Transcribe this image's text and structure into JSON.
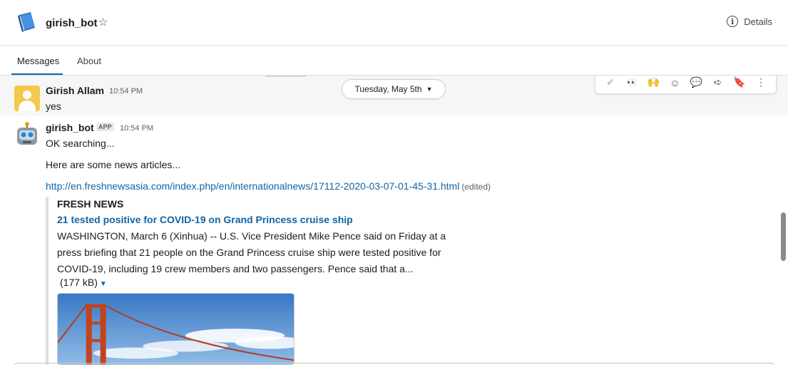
{
  "header": {
    "channel_name": "girish_bot",
    "details_label": "Details"
  },
  "tabs": [
    {
      "label": "Messages",
      "active": true
    },
    {
      "label": "About",
      "active": false
    }
  ],
  "date_divider": "Tuesday, May 5th",
  "message_actions": [
    "white-check-mark-icon",
    "eyes-icon",
    "raised-hands-icon",
    "add-reaction-icon",
    "reply-in-thread-icon",
    "share-icon",
    "bookmark-icon",
    "more-actions-icon"
  ],
  "messages": [
    {
      "sender": "Girish Allam",
      "time": "10:54 PM",
      "text": "yes"
    },
    {
      "sender": "girish_bot",
      "app_badge": "APP",
      "time": "10:54 PM",
      "lines": [
        "OK searching...",
        "Here are some news articles..."
      ],
      "link": "http://en.freshnewsasia.com/index.php/en/internationalnews/17112-2020-03-07-01-45-31.html",
      "edited": "(edited)",
      "attachment": {
        "source": "FRESH NEWS",
        "title": "21 tested positive for COVID-19 on Grand Princess cruise ship",
        "body_lines": [
          "WASHINGTON, March 6 (Xinhua) -- U.S. Vice President Mike Pence said on Friday at a",
          "press briefing that 21 people on the Grand Princess cruise ship were tested positive for",
          "COVID-19, including 19 crew members and two passengers. Pence said that a..."
        ],
        "size": "(177 kB)"
      }
    }
  ],
  "colors": {
    "link": "#1264a3",
    "tab_underline": "#1264a3",
    "hover_bg": "#f6f6f6"
  }
}
